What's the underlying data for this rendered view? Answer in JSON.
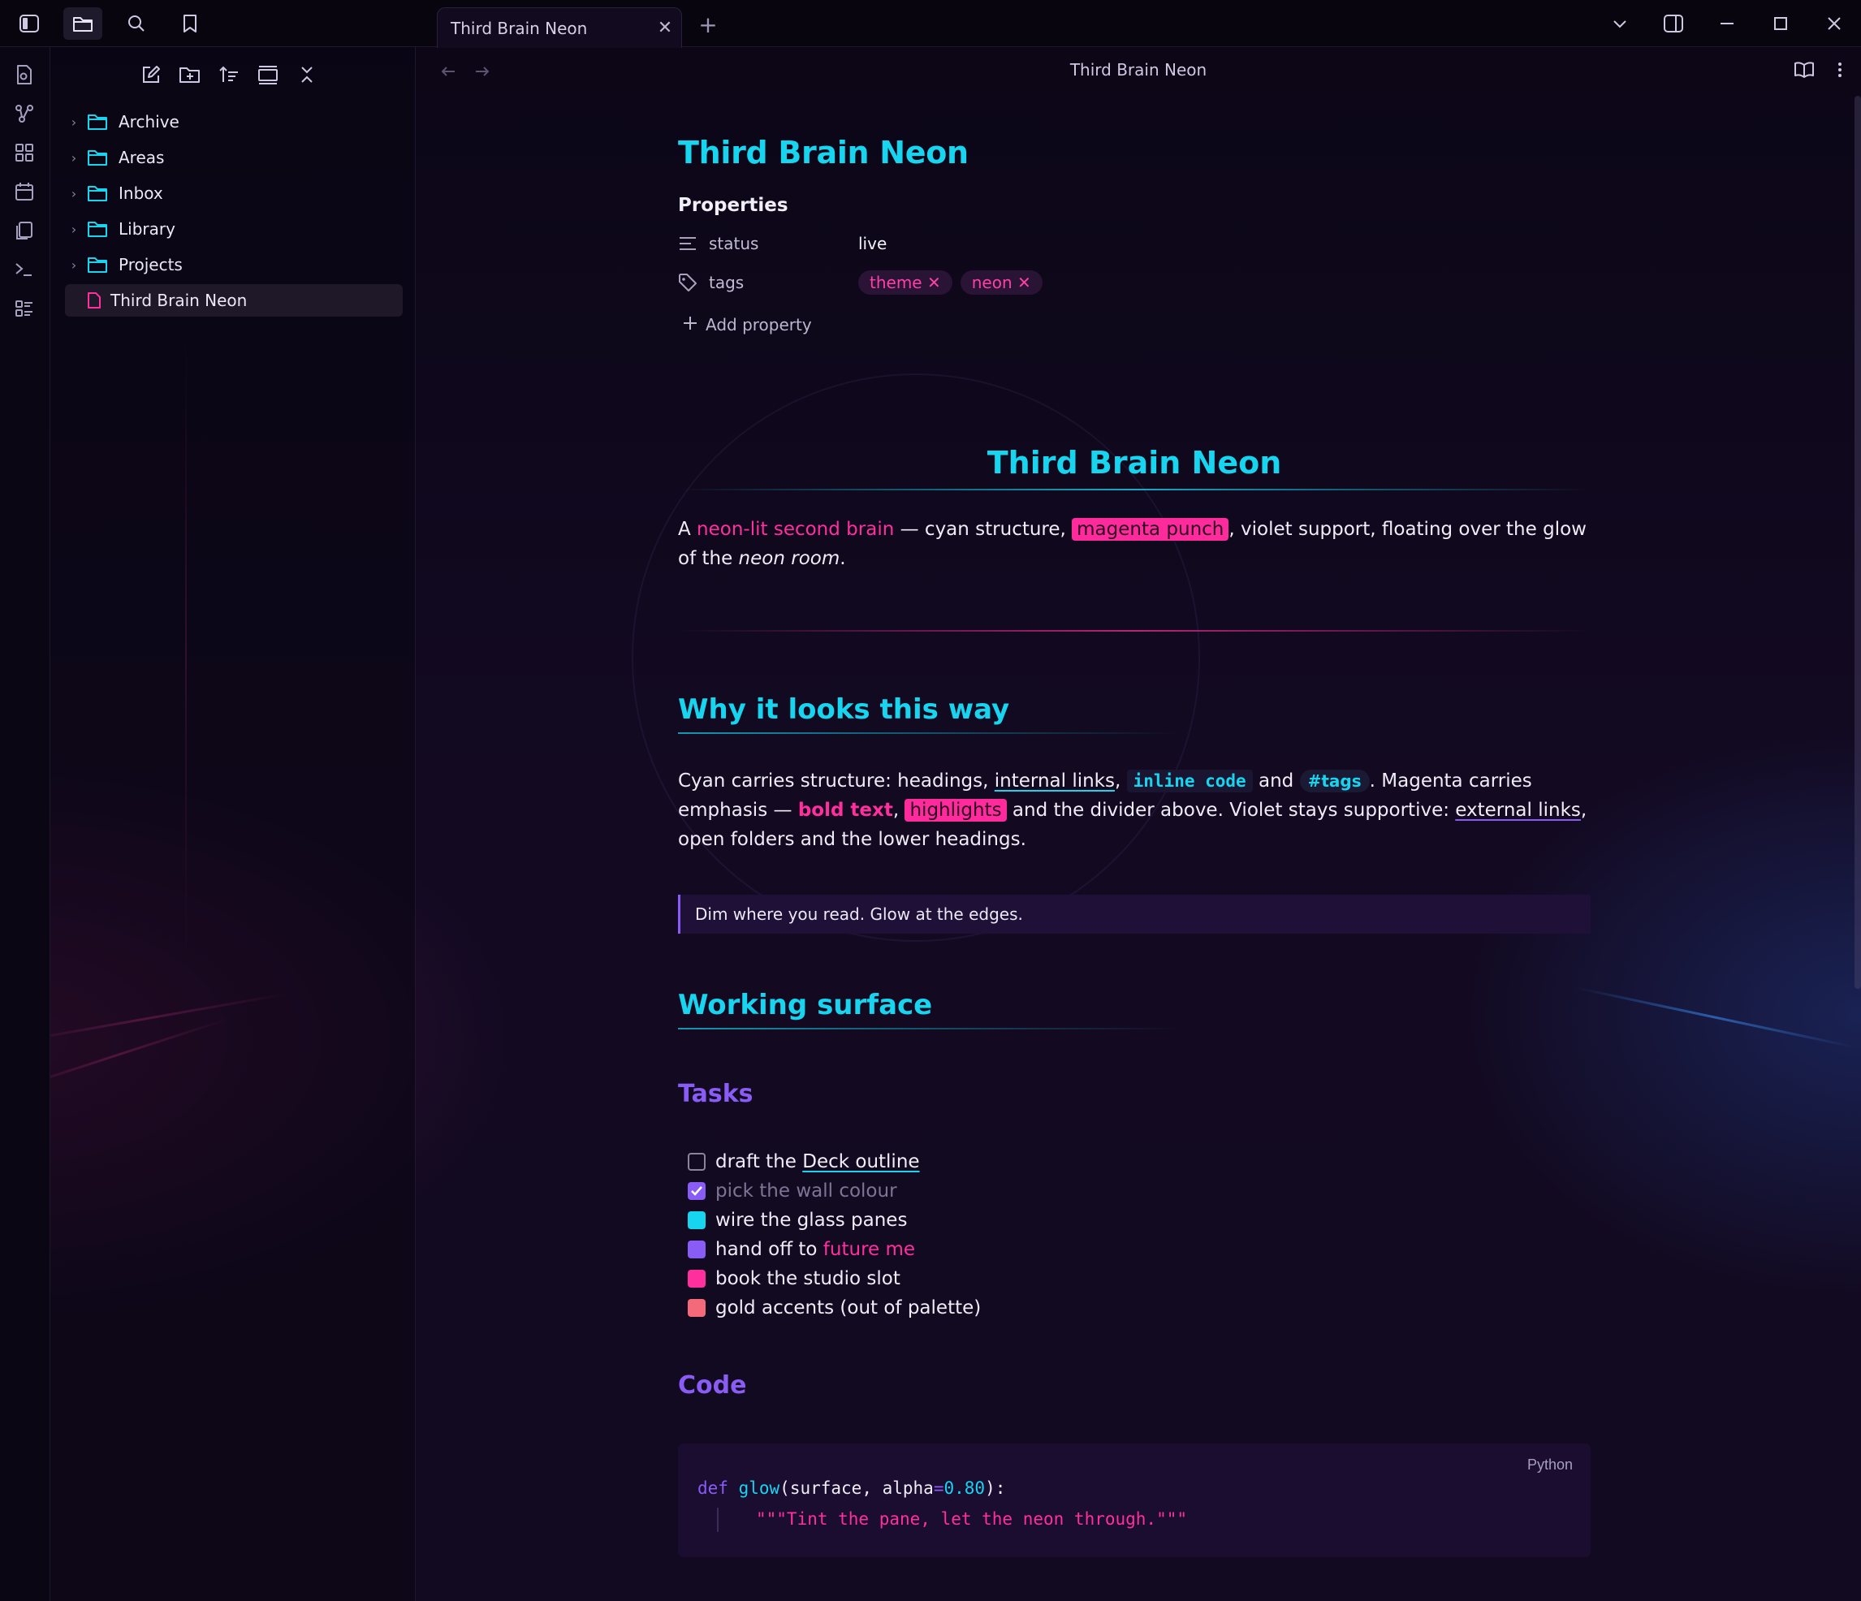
{
  "window": {
    "tab_title": "Third Brain Neon",
    "tab_close": "✕",
    "tab_add": "+"
  },
  "sidebar": {
    "folders": [
      {
        "label": "Archive"
      },
      {
        "label": "Areas"
      },
      {
        "label": "Inbox"
      },
      {
        "label": "Library"
      },
      {
        "label": "Projects"
      }
    ],
    "active_file": "Third Brain Neon"
  },
  "nav": {
    "title": "Third Brain Neon"
  },
  "note": {
    "inline_title": "Third Brain Neon",
    "properties_heading": "Properties",
    "properties": {
      "status_key": "status",
      "status_value": "live",
      "tags_key": "tags",
      "tags": [
        "theme",
        "neon"
      ],
      "add_property": "Add property"
    },
    "h1": "Third Brain Neon",
    "intro": {
      "a": "A ",
      "link": "neon-lit second brain",
      "b": " — cyan structure, ",
      "mark": "magenta punch",
      "c": ", violet support, floating over the glow of the ",
      "em": "neon room",
      "d": "."
    },
    "h2_why": "Why it looks this way",
    "why": {
      "a": "Cyan carries structure: headings, ",
      "internal_link": "internal links",
      "b": ", ",
      "inline_code": "inline code",
      "c": " and ",
      "tag": "#tags",
      "d": ". Magenta carries emphasis — ",
      "bold": "bold text",
      "e": ", ",
      "highlight": "highlights",
      "f": " and the divider above. Violet stays supportive: ",
      "external_link": "external links",
      "g": ", open folders and the lower headings."
    },
    "callout": "Dim where you read. Glow at the edges.",
    "h2_work": "Working surface",
    "h3_tasks": "Tasks",
    "tasks": [
      {
        "pre": "draft the ",
        "link": "Deck outline",
        "post": "",
        "state": "empty"
      },
      {
        "pre": "pick the wall colour",
        "link": "",
        "post": "",
        "state": "done"
      },
      {
        "pre": "wire the glass panes",
        "link": "",
        "post": "",
        "state": "cyan"
      },
      {
        "pre": "hand off to ",
        "link": "",
        "post": "future me",
        "state": "violet"
      },
      {
        "pre": "book the studio slot",
        "link": "",
        "post": "",
        "state": "magenta"
      },
      {
        "pre": "gold accents (out of palette)",
        "link": "",
        "post": "",
        "state": "coral"
      }
    ],
    "h3_code": "Code",
    "code": {
      "lang": "Python",
      "kw_def": "def",
      "fn_name": "glow",
      "args_a": "(surface, alpha",
      "eq": "=",
      "num": "0.80",
      "args_b": "):",
      "docstring": "\"\"\"Tint the pane, let the neon through.\"\"\""
    }
  },
  "colors": {
    "cyan": "#17d4ef",
    "magenta": "#ff2f9e",
    "violet": "#8a5cf6",
    "coral": "#f46a7a",
    "background": "#0d0718"
  }
}
